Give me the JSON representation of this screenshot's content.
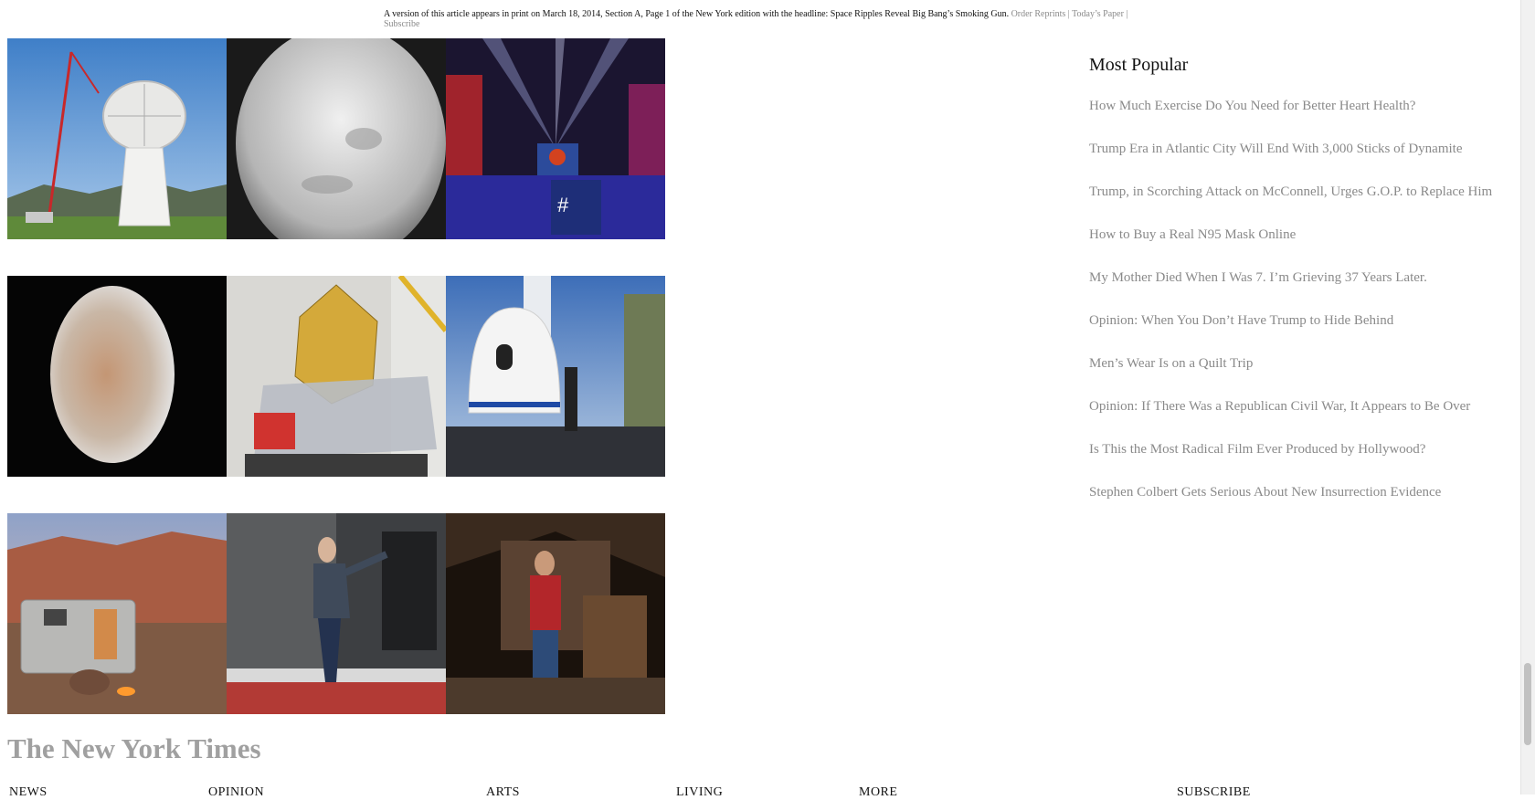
{
  "print_note": {
    "text": "A version of this article appears in print on March 18, 2014, Section A, Page 1 of the New York edition with the headline: Space Ripples Reveal Big Bang’s Smoking Gun.",
    "order_reprints": "Order Reprints",
    "sep1": "|",
    "todays_paper": "Today’s Paper",
    "sep2": "|",
    "subscribe": "Subscribe"
  },
  "most_popular": {
    "heading": "Most Popular",
    "items": [
      "How Much Exercise Do You Need for Better Heart Health?",
      "Trump Era in Atlantic City Will End With 3,000 Sticks of Dynamite",
      "Trump, in Scorching Attack on McConnell, Urges G.O.P. to Replace Him",
      "How to Buy a Real N95 Mask Online",
      "My Mother Died When I Was 7. I’m Grieving 37 Years Later.",
      "Opinion: When You Don’t Have Trump to Hide Behind",
      "Men’s Wear Is on a Quilt Trip",
      "Opinion: If There Was a Republican Civil War, It Appears to Be Over",
      "Is This the Most Radical Film Ever Produced by Hollywood?",
      "Stephen Colbert Gets Serious About New Insurrection Evidence"
    ]
  },
  "images": [
    "radio-telescope-dish-photo",
    "planet-grayscale-photo",
    "arabs-to-mars-event-photo",
    "venus-planet-photo",
    "space-telescope-cleanroom-photo",
    "space-capsule-photo",
    "camper-trailer-desert-photo",
    "woman-leaping-photo",
    "man-in-attic-photo"
  ],
  "masthead": "The New York Times",
  "footer_nav": [
    "NEWS",
    "OPINION",
    "ARTS",
    "LIVING",
    "MORE",
    "SUBSCRIBE"
  ],
  "colors": {
    "link_gray": "#8a8a8a",
    "masthead_gray": "#a0a0a0"
  }
}
